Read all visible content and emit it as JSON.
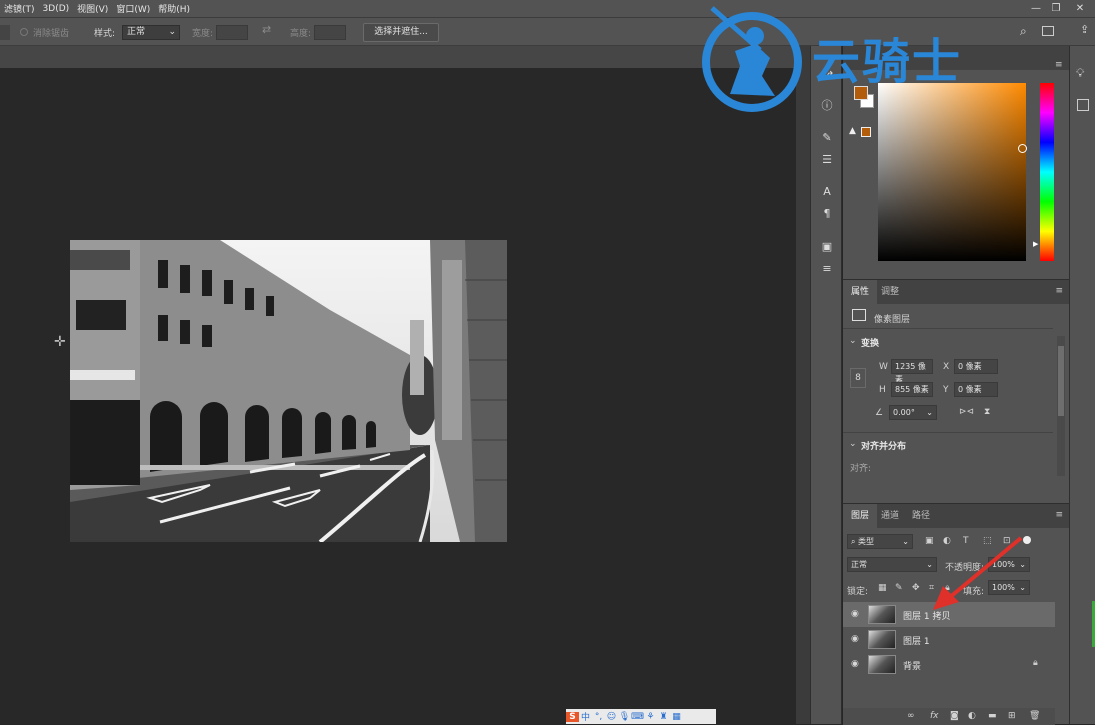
{
  "menubar": {
    "items": [
      "滤镜(T)",
      "3D(D)",
      "视图(V)",
      "窗口(W)",
      "帮助(H)"
    ],
    "window_controls": [
      "—",
      "❐",
      "✕"
    ]
  },
  "options": {
    "antialias_label": "消除锯齿",
    "style_label": "样式:",
    "style_value": "正常",
    "width_label": "宽度:",
    "height_label": "高度:",
    "select_mask_button": "选择并遮住..."
  },
  "watermark": {
    "text": "云骑士"
  },
  "color_panel": {
    "foreground": "#b35d0b",
    "background": "#ffffff",
    "hue": "#ff8a00"
  },
  "properties": {
    "tabs": [
      "属性",
      "调整"
    ],
    "layer_type": "像素图层",
    "transform_title": "变换",
    "w_label": "W",
    "w_value": "1235 像素",
    "h_label": "H",
    "h_value": "855 像素",
    "x_label": "X",
    "x_value": "0 像素",
    "y_label": "Y",
    "y_value": "0 像素",
    "angle_value": "0.00°",
    "align_title": "对齐并分布",
    "align_label": "对齐:"
  },
  "layers": {
    "tabs": [
      "图层",
      "通道",
      "路径"
    ],
    "filter_kind": "类型",
    "blend_mode": "正常",
    "opacity_label": "不透明度:",
    "opacity_value": "100%",
    "lock_label": "锁定:",
    "fill_label": "填充:",
    "fill_value": "100%",
    "items": [
      {
        "name": "图层 1 拷贝",
        "selected": true
      },
      {
        "name": "图层 1",
        "selected": false
      },
      {
        "name": "背景",
        "selected": false,
        "locked": true
      }
    ]
  },
  "taskbar": {
    "ime_label": "中"
  }
}
